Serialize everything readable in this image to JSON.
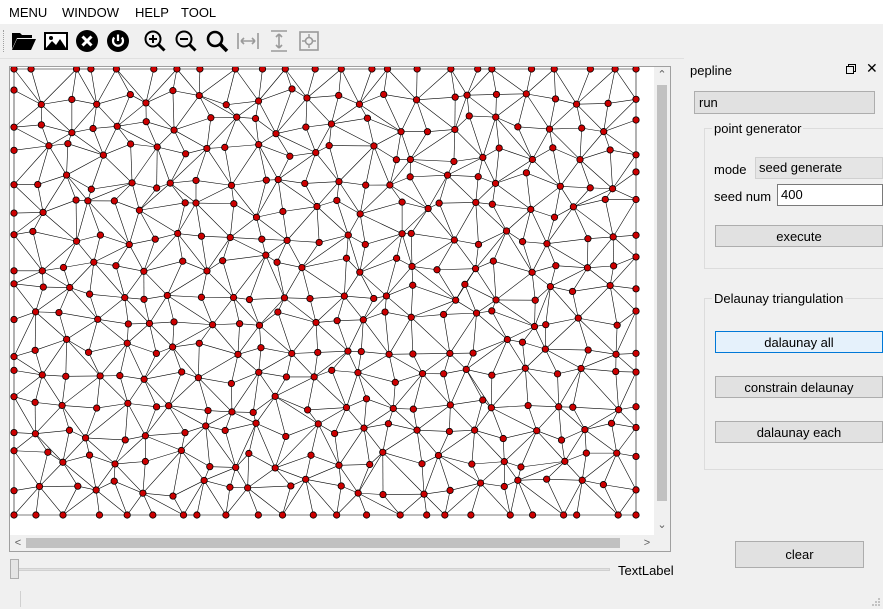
{
  "menu": [
    "MENU",
    "WINDOW",
    "HELP",
    "TOOL"
  ],
  "toolbar": {
    "icons": [
      "folder-open-icon",
      "image-icon",
      "close-circle-icon",
      "power-icon",
      "zoom-in-icon",
      "zoom-out-icon",
      "search-icon",
      "fit-width-icon",
      "fit-height-icon",
      "fit-view-icon"
    ]
  },
  "canvas": {
    "point_color": "#cc0000",
    "edge_color": "#000000",
    "scroll_left": "<",
    "scroll_right": ">",
    "scroll_up": "^",
    "scroll_down": "v"
  },
  "text_label": "TextLabel",
  "dock": {
    "title": "pepline",
    "run_label": "run",
    "point_generator": {
      "title": "point generator",
      "mode_label": "mode",
      "mode_value": "seed generate",
      "seed_label": "seed num",
      "seed_value": "400",
      "execute_label": "execute"
    },
    "delaunay": {
      "title": "Delaunay triangulation",
      "all_label": "dalaunay all",
      "constrain_label": "constrain delaunay",
      "each_label": "dalaunay each"
    },
    "clear_label": "clear"
  }
}
